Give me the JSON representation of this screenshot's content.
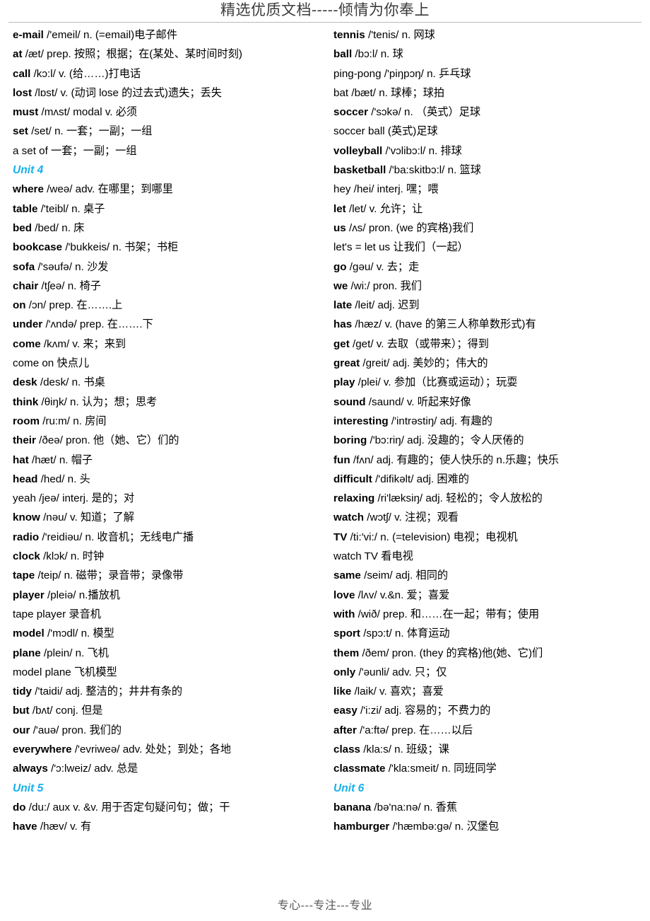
{
  "header": {
    "title": "精选优质文档-----倾情为你奉上"
  },
  "footer": {
    "text": "专心---专注---专业"
  },
  "columns": {
    "left": [
      {
        "type": "entry",
        "headword": "e-mail",
        "bold": true,
        "rest": "/'emeil/ n. (=email)电子邮件"
      },
      {
        "type": "entry",
        "headword": "at",
        "bold": true,
        "rest": "/æt/ prep. 按照；根据；在(某处、某时间时刻)"
      },
      {
        "type": "entry",
        "headword": "call",
        "bold": true,
        "rest": "/kɔ:l/ v. (给……)打电话"
      },
      {
        "type": "entry",
        "headword": "lost",
        "bold": true,
        "rest": "/lɒst/ v. (动词 lose 的过去式)遗失；丢失"
      },
      {
        "type": "entry",
        "headword": "must",
        "bold": true,
        "rest": "/mʌst/ modal v. 必须"
      },
      {
        "type": "entry",
        "headword": "set",
        "bold": true,
        "rest": "/set/ n. 一套；一副；一组"
      },
      {
        "type": "entry",
        "headword": "a set of",
        "bold": false,
        "rest": "一套；一副；一组"
      },
      {
        "type": "unit",
        "label": "Unit 4"
      },
      {
        "type": "entry",
        "headword": "where",
        "bold": true,
        "rest": "/weə/ adv. 在哪里；到哪里"
      },
      {
        "type": "entry",
        "headword": "table",
        "bold": true,
        "rest": "/'teibl/ n. 桌子"
      },
      {
        "type": "entry",
        "headword": "bed",
        "bold": true,
        "rest": "/bed/ n. 床"
      },
      {
        "type": "entry",
        "headword": "bookcase",
        "bold": true,
        "rest": "/'bukkeis/ n. 书架；书柜"
      },
      {
        "type": "entry",
        "headword": "sofa",
        "bold": true,
        "rest": "/'səufə/ n. 沙发"
      },
      {
        "type": "entry",
        "headword": "chair",
        "bold": true,
        "rest": "/tʃeə/ n. 椅子"
      },
      {
        "type": "entry",
        "headword": "on",
        "bold": true,
        "rest": "/ɔn/ prep. 在…….上"
      },
      {
        "type": "entry",
        "headword": "under",
        "bold": true,
        "rest": "/'ʌndə/ prep. 在…….下"
      },
      {
        "type": "entry",
        "headword": "come",
        "bold": true,
        "rest": "/kʌm/ v. 来；来到"
      },
      {
        "type": "entry",
        "headword": "come on",
        "bold": false,
        "rest": "快点儿"
      },
      {
        "type": "entry",
        "headword": "desk",
        "bold": true,
        "rest": "/desk/ n. 书桌"
      },
      {
        "type": "entry",
        "headword": "think",
        "bold": true,
        "rest": "/θiŋk/ n. 认为；想；思考"
      },
      {
        "type": "entry",
        "headword": "room",
        "bold": true,
        "rest": "/ru:m/ n. 房间"
      },
      {
        "type": "entry",
        "headword": "their",
        "bold": true,
        "rest": "/ðeə/ pron. 他（她、它）们的"
      },
      {
        "type": "entry",
        "headword": "hat",
        "bold": true,
        "rest": "/hæt/ n. 帽子"
      },
      {
        "type": "entry",
        "headword": "head",
        "bold": true,
        "rest": "/hed/ n. 头"
      },
      {
        "type": "entry",
        "headword": "yeah",
        "bold": false,
        "rest": "/jeə/ interj. 是的；对"
      },
      {
        "type": "entry",
        "headword": "know",
        "bold": true,
        "rest": "/nəu/ v. 知道；了解"
      },
      {
        "type": "entry",
        "headword": "radio",
        "bold": true,
        "rest": "/'reidiəu/ n. 收音机；无线电广播"
      },
      {
        "type": "entry",
        "headword": "clock",
        "bold": true,
        "rest": "/klɔk/ n. 时钟"
      },
      {
        "type": "entry",
        "headword": "tape",
        "bold": true,
        "rest": "/teip/ n. 磁带；录音带；录像带"
      },
      {
        "type": "entry",
        "headword": "player",
        "bold": true,
        "rest": "/pleiə/ n.播放机"
      },
      {
        "type": "entry",
        "headword": "tape player",
        "bold": false,
        "rest": "录音机"
      },
      {
        "type": "entry",
        "headword": "model",
        "bold": true,
        "rest": "/'mɔdl/ n. 模型"
      },
      {
        "type": "entry",
        "headword": "plane",
        "bold": true,
        "rest": "/plein/ n. 飞机"
      },
      {
        "type": "entry",
        "headword": "model plane",
        "bold": false,
        "rest": "飞机模型"
      },
      {
        "type": "entry",
        "headword": "tidy",
        "bold": true,
        "rest": "/'taidi/ adj. 整洁的；井井有条的"
      },
      {
        "type": "entry",
        "headword": "but",
        "bold": true,
        "rest": "/bʌt/ conj. 但是"
      },
      {
        "type": "entry",
        "headword": "our",
        "bold": true,
        "rest": "/'auə/ pron. 我们的"
      },
      {
        "type": "entry",
        "headword": "everywhere",
        "bold": true,
        "rest": "/'evriweə/ adv. 处处；到处；各地"
      },
      {
        "type": "entry",
        "headword": "always",
        "bold": true,
        "rest": "/'ɔ:lweiz/ adv. 总是"
      },
      {
        "type": "unit",
        "label": "Unit 5"
      },
      {
        "type": "entry",
        "headword": "do",
        "bold": true,
        "rest": "/du:/ aux v. &v. 用于否定句疑问句；做；干"
      },
      {
        "type": "entry",
        "headword": "have",
        "bold": true,
        "rest": "/hæv/ v. 有"
      }
    ],
    "right": [
      {
        "type": "entry",
        "headword": "tennis",
        "bold": true,
        "rest": "/'tenis/ n. 网球"
      },
      {
        "type": "entry",
        "headword": "ball",
        "bold": true,
        "rest": "/bɔ:l/ n. 球"
      },
      {
        "type": "entry",
        "headword": "ping-pong",
        "bold": false,
        "rest": "/'piŋpɔŋ/ n. 乒乓球"
      },
      {
        "type": "entry",
        "headword": "bat",
        "bold": false,
        "rest": "/bæt/ n. 球棒；球拍"
      },
      {
        "type": "entry",
        "headword": "soccer",
        "bold": true,
        "rest": "/'sɔkə/ n. （英式）足球"
      },
      {
        "type": "entry",
        "headword": "soccer ball",
        "bold": false,
        "rest": "(英式)足球"
      },
      {
        "type": "entry",
        "headword": "volleyball",
        "bold": true,
        "rest": "/'vɔlibɔ:l/ n. 排球"
      },
      {
        "type": "entry",
        "headword": "basketball",
        "bold": true,
        "rest": "/'ba:skitbɔ:l/ n. 篮球"
      },
      {
        "type": "entry",
        "headword": "hey",
        "bold": false,
        "rest": "/hei/ interj. 嘿；喂"
      },
      {
        "type": "entry",
        "headword": "let",
        "bold": true,
        "rest": "/let/ v. 允许；让"
      },
      {
        "type": "entry",
        "headword": "us",
        "bold": true,
        "rest": "/ʌs/ pron. (we 的宾格)我们"
      },
      {
        "type": "entry",
        "headword": "let's = let us",
        "bold": false,
        "rest": "让我们（一起）"
      },
      {
        "type": "entry",
        "headword": "go",
        "bold": true,
        "rest": "/gəu/ v. 去；走"
      },
      {
        "type": "entry",
        "headword": "we",
        "bold": true,
        "rest": "/wi:/ pron. 我们"
      },
      {
        "type": "entry",
        "headword": "late",
        "bold": true,
        "rest": "/leit/ adj. 迟到"
      },
      {
        "type": "entry",
        "headword": "has",
        "bold": true,
        "rest": "/hæz/ v. (have 的第三人称单数形式)有"
      },
      {
        "type": "entry",
        "headword": "get",
        "bold": true,
        "rest": "/get/ v. 去取（或带来）；得到"
      },
      {
        "type": "entry",
        "headword": "great",
        "bold": true,
        "rest": "/greit/ adj. 美妙的；伟大的"
      },
      {
        "type": "entry",
        "headword": "play",
        "bold": true,
        "rest": "/plei/ v. 参加（比赛或运动）；玩耍"
      },
      {
        "type": "entry",
        "headword": "sound",
        "bold": true,
        "rest": "/saund/ v. 听起来好像"
      },
      {
        "type": "entry",
        "headword": "interesting",
        "bold": true,
        "rest": "/'intrəstiŋ/ adj. 有趣的"
      },
      {
        "type": "entry",
        "headword": "boring",
        "bold": true,
        "rest": "/'bɔ:riŋ/ adj. 没趣的；令人厌倦的"
      },
      {
        "type": "entry",
        "headword": "fun",
        "bold": true,
        "rest": "/fʌn/ adj. 有趣的；使人快乐的 n.乐趣；快乐"
      },
      {
        "type": "entry",
        "headword": "difficult",
        "bold": true,
        "rest": "/'difikəlt/ adj. 困难的"
      },
      {
        "type": "entry",
        "headword": "relaxing",
        "bold": true,
        "rest": "/ri'læksiŋ/ adj. 轻松的；令人放松的"
      },
      {
        "type": "entry",
        "headword": "watch",
        "bold": true,
        "rest": "/wɔtʃ/ v. 注视；观看"
      },
      {
        "type": "entry",
        "headword": "TV",
        "bold": true,
        "rest": "/ti:'vi:/ n. (=television) 电视；电视机"
      },
      {
        "type": "entry",
        "headword": "watch TV",
        "bold": false,
        "rest": "看电视"
      },
      {
        "type": "entry",
        "headword": "same",
        "bold": true,
        "rest": "/seim/ adj. 相同的"
      },
      {
        "type": "entry",
        "headword": "love",
        "bold": true,
        "rest": "/lʌv/ v.&n. 爱；喜爱"
      },
      {
        "type": "entry",
        "headword": "with",
        "bold": true,
        "rest": "/wið/ prep. 和……在一起；带有；使用"
      },
      {
        "type": "entry",
        "headword": "sport",
        "bold": true,
        "rest": "/spɔ:t/ n. 体育运动"
      },
      {
        "type": "entry",
        "headword": "them",
        "bold": true,
        "rest": "/ðem/ pron. (they 的宾格)他(她、它)们"
      },
      {
        "type": "entry",
        "headword": "only",
        "bold": true,
        "rest": "/'əunli/ adv. 只；仅"
      },
      {
        "type": "entry",
        "headword": "like",
        "bold": true,
        "rest": "/laik/ v. 喜欢；喜爱"
      },
      {
        "type": "entry",
        "headword": "easy",
        "bold": true,
        "rest": "/'i:zi/ adj. 容易的；不费力的"
      },
      {
        "type": "entry",
        "headword": "after",
        "bold": true,
        "rest": "/'a:ftə/ prep. 在……以后"
      },
      {
        "type": "entry",
        "headword": "class",
        "bold": true,
        "rest": "/kla:s/ n. 班级；课"
      },
      {
        "type": "entry",
        "headword": "classmate",
        "bold": true,
        "rest": "/'kla:smeit/ n. 同班同学"
      },
      {
        "type": "unit",
        "label": "Unit 6"
      },
      {
        "type": "entry",
        "headword": "banana",
        "bold": true,
        "rest": "/bə'na:nə/ n. 香蕉"
      },
      {
        "type": "entry",
        "headword": "hamburger",
        "bold": true,
        "rest": "/'hæmbə:gə/ n. 汉堡包"
      }
    ]
  },
  "colors": {
    "unit_heading": "#17b0ec",
    "header_text": "#3a3a3a",
    "footer_text": "#555555",
    "rule": "#b9b9b9",
    "body_text": "#000000"
  }
}
